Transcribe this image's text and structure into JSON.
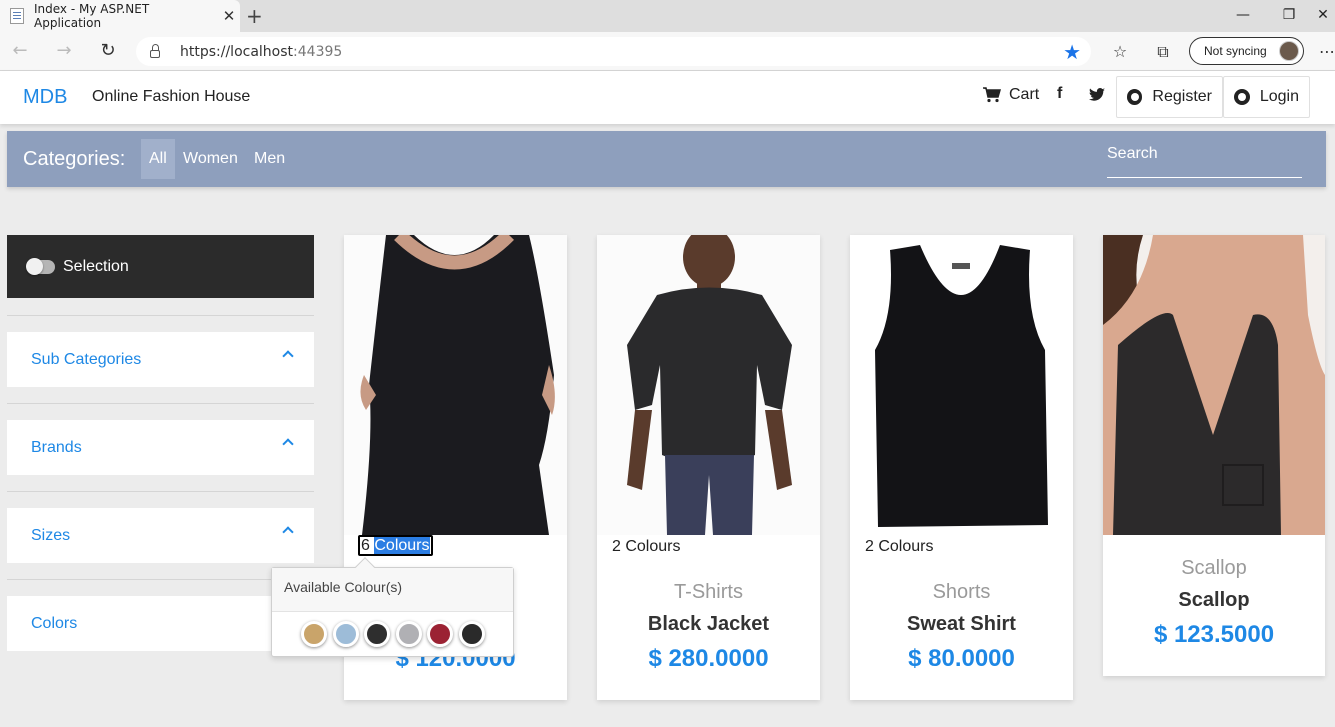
{
  "browser": {
    "tab_title": "Index - My ASP.NET Application",
    "url_host": "https://localhost",
    "url_port": ":44395",
    "sync_label": "Not syncing"
  },
  "site": {
    "brand": "MDB",
    "name": "Online Fashion House",
    "cart_label": "Cart",
    "register_label": "Register",
    "login_label": "Login"
  },
  "categories": {
    "label": "Categories:",
    "items": [
      "All",
      "Women",
      "Men"
    ],
    "active": "All",
    "search_placeholder": "Search"
  },
  "sidebar": {
    "selection_label": "Selection",
    "filters": [
      "Sub Categories",
      "Brands",
      "Sizes",
      "Colors"
    ]
  },
  "products": [
    {
      "colours_count": "6",
      "colours_word": "Colours",
      "subcategory": "",
      "name": "",
      "price": "$ 120.0000"
    },
    {
      "colours_label": "2 Colours",
      "subcategory": "T-Shirts",
      "name": "Black Jacket",
      "price": "$ 280.0000"
    },
    {
      "colours_label": "2 Colours",
      "subcategory": "Shorts",
      "name": "Sweat Shirt",
      "price": "$ 80.0000"
    },
    {
      "colours_label": "",
      "subcategory": "Scallop",
      "name": "Scallop",
      "price": "$ 123.5000"
    }
  ],
  "popover": {
    "title": "Available Colour(s)",
    "swatches": [
      "#c9a46a",
      "#9dbcd8",
      "#2e2e2e",
      "#b0b0b4",
      "#9b2233",
      "#2a2a2a"
    ]
  },
  "colors": {
    "accent": "#1e88e5",
    "category_bar": "#8e9fbd",
    "selection_bg": "#2b2b2b"
  }
}
